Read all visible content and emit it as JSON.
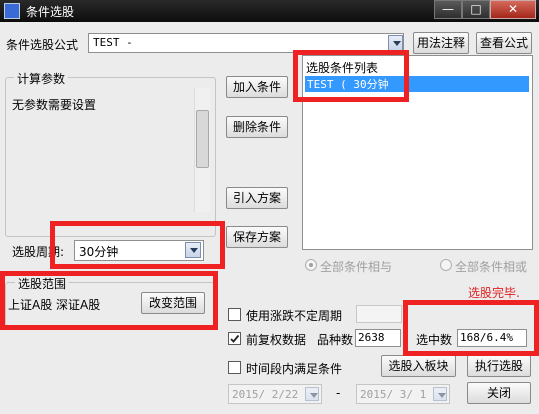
{
  "window": {
    "title": "条件选股",
    "min": "—",
    "max": "□",
    "close": "✕"
  },
  "formula": {
    "label": "条件选股公式",
    "value": "TEST     -",
    "usage_button": "用法注释",
    "view_button": "查看公式"
  },
  "params": {
    "group_label": "计算参数",
    "text": "无参数需要设置"
  },
  "conditions": {
    "group_label": "选股条件列表",
    "items": [
      "TEST  ( 30分钟"
    ]
  },
  "actions": {
    "add": "加入条件",
    "delete": "删除条件",
    "import": "引入方案",
    "save": "保存方案"
  },
  "period": {
    "label": "选股周期:",
    "value": "30分钟"
  },
  "logic": {
    "all_and": "全部条件相与",
    "all_or": "全部条件相或"
  },
  "status": {
    "text": "选股完毕.",
    "color": "#e02020"
  },
  "range": {
    "group_label": "选股范围",
    "text": "上证A股 深证A股",
    "change_button": "改变范围"
  },
  "options": {
    "use_unfixed": "使用涨跌不定周期",
    "pre_adjust": "前复权数据",
    "time_range": "时间段内满足条件"
  },
  "stats": {
    "count_label": "品种数",
    "count_value": "2638",
    "hit_label": "选中数",
    "hit_value": "168/6.4%"
  },
  "buttons": {
    "to_block": "选股入板块",
    "execute": "执行选股",
    "close": "关闭"
  },
  "dates": {
    "start": "2015/ 2/22",
    "dash": "-",
    "end": "2015/ 3/ 1"
  },
  "colors": {
    "highlight": "#3399ff",
    "annotation": "#ee2222"
  }
}
